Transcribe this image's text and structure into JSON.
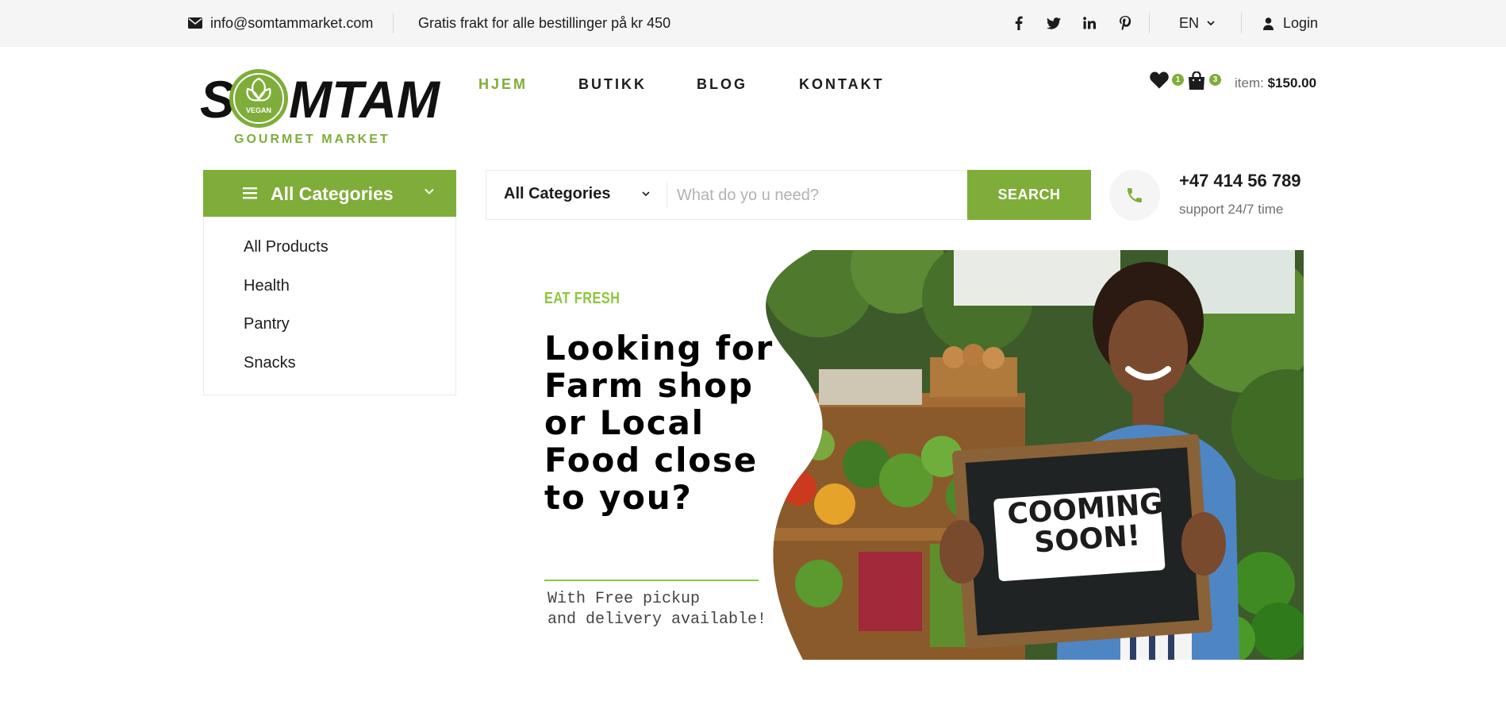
{
  "topbar": {
    "email": "info@somtammarket.com",
    "shipping": "Gratis frakt for alle bestillinger på kr 450",
    "social": [
      "facebook-icon",
      "twitter-icon",
      "linkedin-icon",
      "pinterest-icon"
    ],
    "language": "EN",
    "login": "Login"
  },
  "logo": {
    "brand_left": "S",
    "brand_right": "MTAM",
    "badge": "VEGAN",
    "tagline": "GOURMET MARKET"
  },
  "nav": {
    "items": [
      {
        "label": "HJEM",
        "active": true
      },
      {
        "label": "BUTIKK",
        "active": false
      },
      {
        "label": "BLOG",
        "active": false
      },
      {
        "label": "KONTAKT",
        "active": false
      }
    ]
  },
  "header": {
    "wishlist_count": "1",
    "cart_count": "3",
    "cart_label": "item:",
    "cart_total": "$150.00"
  },
  "categories": {
    "title": "All Categories",
    "items": [
      "All Products",
      "Health",
      "Pantry",
      "Snacks"
    ]
  },
  "search": {
    "category": "All Categories",
    "placeholder": "What do yo u need?",
    "button": "SEARCH"
  },
  "contact": {
    "phone": "+47 414 56 789",
    "support": "support 24/7 time"
  },
  "hero": {
    "eyebrow": "EAT FRESH",
    "headline": "Looking for Farm shop or Local Food close to you?",
    "sub_line1": "With Free pickup",
    "sub_line2": "and delivery available!",
    "sign_text": "COOMING SOON!"
  },
  "colors": {
    "accent": "#7fad39",
    "accent_light": "#8cc63f",
    "topbar_bg": "#f5f5f5",
    "text": "#1c1c1c"
  }
}
